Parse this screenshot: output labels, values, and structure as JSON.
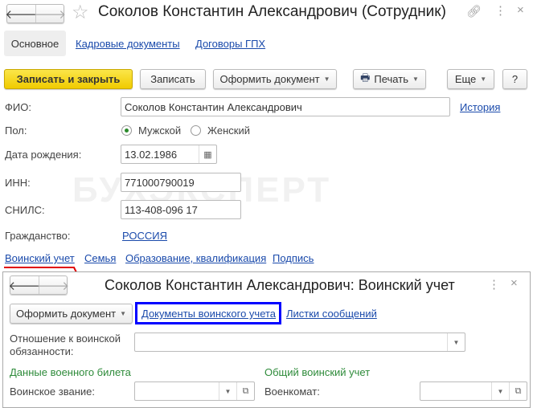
{
  "window": {
    "title": "Соколов Константин Александрович (Сотрудник)",
    "back": "🡐",
    "forward": "🡒"
  },
  "tabs": [
    {
      "label": "Основное"
    },
    {
      "label": "Кадровые документы"
    },
    {
      "label": "Договоры ГПХ"
    }
  ],
  "toolbar": {
    "save_close": "Записать и закрыть",
    "save": "Записать",
    "create_doc": "Оформить документ",
    "print": "Печать",
    "more": "Еще",
    "help": "?"
  },
  "form": {
    "fio_label": "ФИО:",
    "fio_value": "Соколов Константин Александрович",
    "history": "История",
    "gender_label": "Пол:",
    "male": "Мужской",
    "female": "Женский",
    "birth_label": "Дата рождения:",
    "birth_value": "13.02.1986",
    "inn_label": "ИНН:",
    "inn_value": "771000790019",
    "snils_label": "СНИЛС:",
    "snils_value": "113-408-096 17",
    "citizenship_label": "Гражданство:",
    "citizenship_value": "РОССИЯ"
  },
  "sections": [
    {
      "label": "Воинский учет"
    },
    {
      "label": "Семья"
    },
    {
      "label": "Образование, квалификация"
    },
    {
      "label": "Подпись"
    }
  ],
  "watermark": "БУХЭКСПЕРТ",
  "subwindow": {
    "title": "Соколов Константин Александрович: Воинский учет",
    "create_doc": "Оформить документ",
    "docs_link": "Документы воинского учета",
    "messages_link": "Листки сообщений",
    "attitude_label": "Отношение к воинской обязанности:",
    "ticket_heading": "Данные военного билета",
    "general_heading": "Общий воинский учет",
    "rank_label": "Воинское звание:",
    "office_label": "Военкомат:"
  },
  "colors": {
    "accent": "#f5d300",
    "link": "#1a4aab",
    "highlight": "#0000ff",
    "marker": "#e00000",
    "section": "#2e8b3a"
  }
}
